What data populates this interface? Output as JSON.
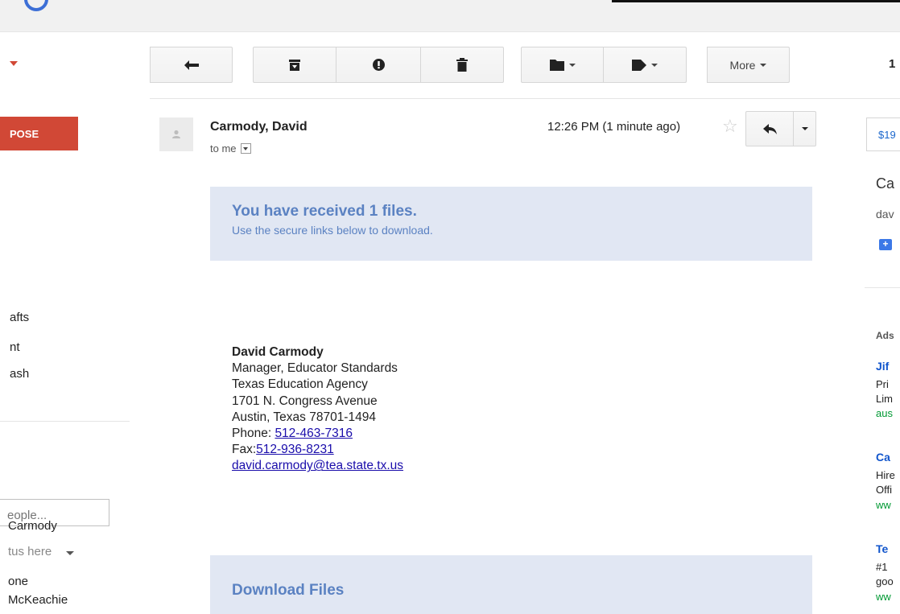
{
  "toolbar": {
    "more_label": "More",
    "page_count": "1"
  },
  "sidebar": {
    "compose_label": "POSE",
    "nav_items": [
      "afts",
      "nt",
      "ash"
    ],
    "people_placeholder": "eople...",
    "chat": {
      "self_name": "Carmody",
      "status": "tus here",
      "contacts": [
        "one",
        "McKeachie"
      ]
    }
  },
  "message": {
    "sender": "Carmody, David",
    "recipient_line": "to me",
    "timestamp": "12:26 PM (1 minute ago)",
    "banner_title": "You have received 1 files.",
    "banner_subtitle": "Use the secure links below to download.",
    "signature": {
      "name": "David Carmody",
      "title": "Manager, Educator Standards",
      "agency": "Texas Education Agency",
      "street": "1701 N. Congress Avenue",
      "city": "Austin, Texas 78701-1494",
      "phone_label": "Phone: ",
      "phone": "512-463-7316",
      "fax_label": "Fax:",
      "fax": "512-936-8231",
      "email": "david.carmody@tea.state.tx.us"
    },
    "download_title": "Download Files"
  },
  "right_panel": {
    "price_pill": "$19",
    "contact_name": "Ca",
    "contact_email": "dav",
    "ads_label": "Ads",
    "ads": [
      {
        "title": "Jif",
        "lines": [
          "Pri",
          "Lim"
        ],
        "url": "aus"
      },
      {
        "title": "Ca",
        "lines": [
          "Hire",
          "Offi"
        ],
        "url": "ww"
      },
      {
        "title": "Te",
        "lines": [
          "#1",
          "goo"
        ],
        "url": "ww"
      }
    ]
  },
  "colors": {
    "compose": "#d14836",
    "banner_bg": "#e1e7f3",
    "banner_text": "#5b82c2",
    "link": "#1a0dab"
  }
}
